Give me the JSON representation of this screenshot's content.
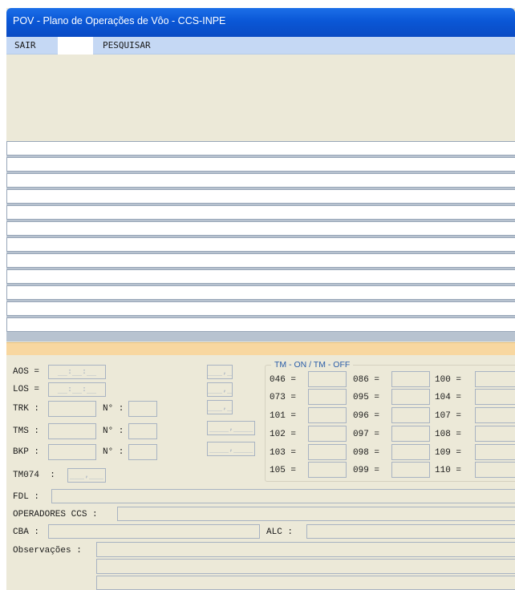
{
  "window": {
    "title": "POV - Plano de Operações de Vôo - CCS-INPE"
  },
  "menu": {
    "sair": "SAIR",
    "pesquisar": "PESQUISAR"
  },
  "form": {
    "aos": {
      "label": "AOS =",
      "mask": "__:__:__"
    },
    "los": {
      "label": "LOS =",
      "mask": "__:__:__"
    },
    "trk": {
      "label": "TRK :",
      "n_label": "N° :"
    },
    "tms": {
      "label": "TMS :",
      "n_label": "N° :"
    },
    "bkp": {
      "label": "BKP :",
      "n_label": "N° :"
    },
    "tm074": {
      "label": "TM074  :",
      "mask": "___,___"
    },
    "freq_masks": [
      "___,___",
      "___,___",
      "___,___",
      "____,____",
      "____,____"
    ],
    "fdl": {
      "label": "FDL :"
    },
    "operadores": {
      "label": "OPERADORES CCS :"
    },
    "cba": {
      "label": "CBA :"
    },
    "alc": {
      "label": "ALC :"
    },
    "observacoes": {
      "label": "Observações :"
    }
  },
  "tm_group": {
    "title": "TM - ON / TM - OFF",
    "columns": [
      [
        "046 =",
        "073 =",
        "101 =",
        "102 =",
        "103 =",
        "105 ="
      ],
      [
        "086 =",
        "095 =",
        "096 =",
        "097 =",
        "098 =",
        "099 ="
      ],
      [
        "100 =",
        "104 =",
        "107 =",
        "108 =",
        "109 =",
        "110 ="
      ]
    ]
  }
}
